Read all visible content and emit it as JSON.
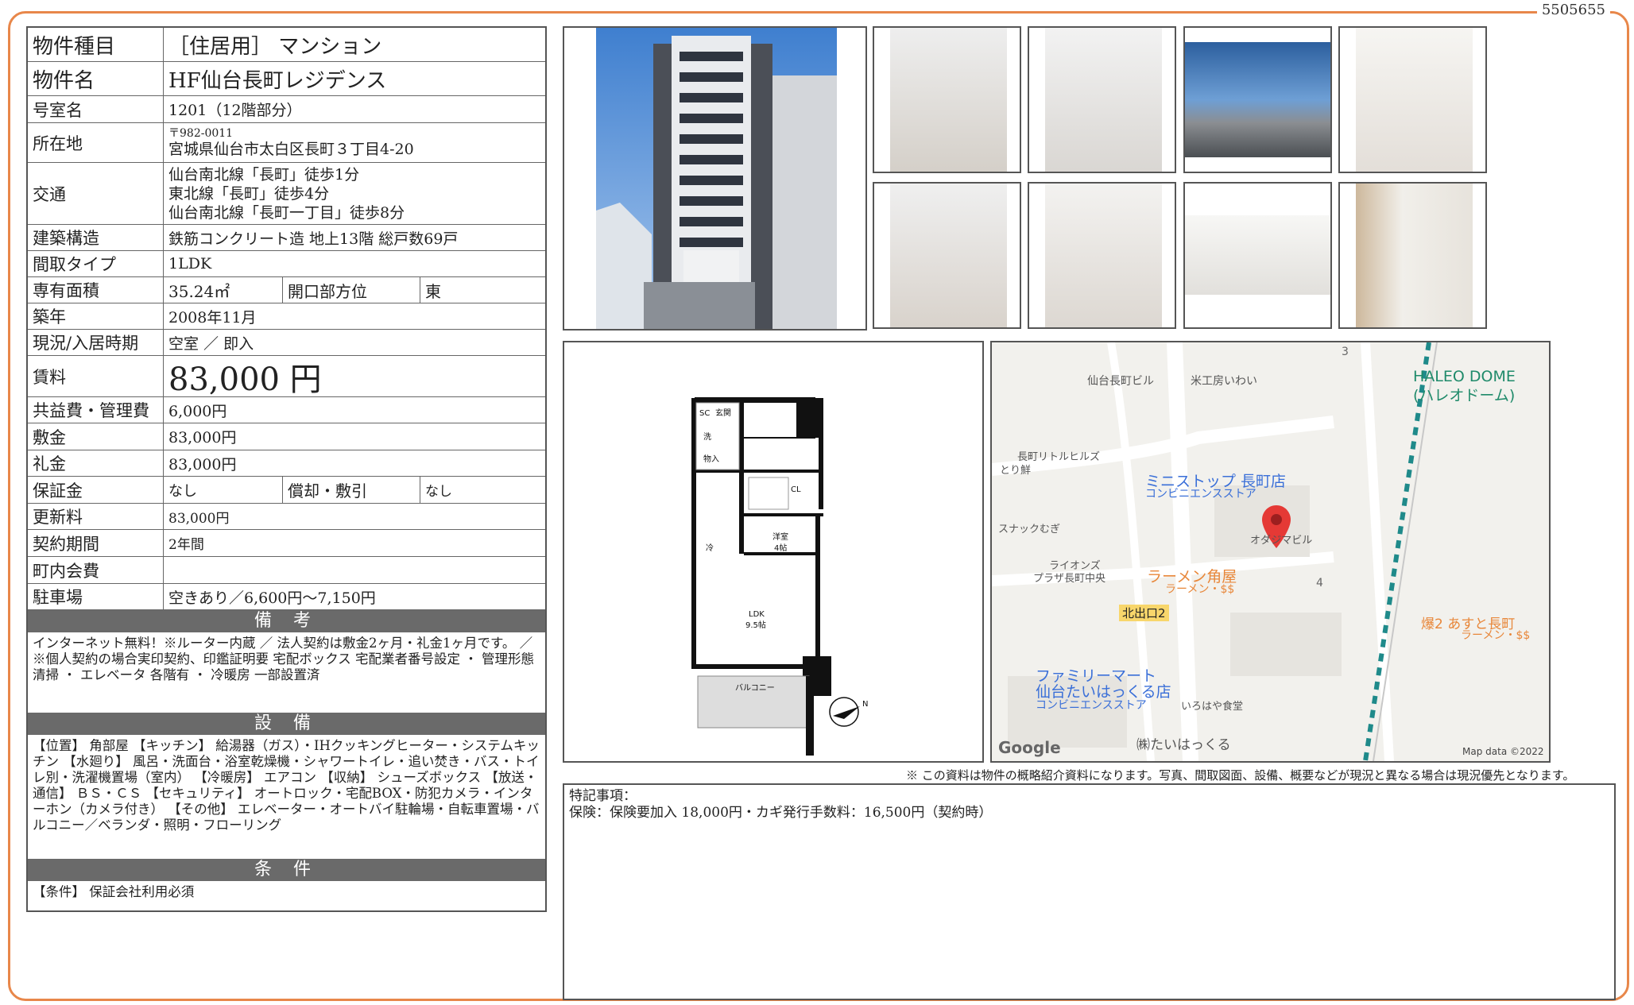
{
  "doc_id": "5505655",
  "spec": {
    "rows": [
      {
        "label": "物件種目",
        "value": "［住居用］ マンション"
      },
      {
        "label": "物件名",
        "value": "HF仙台長町レジデンス"
      },
      {
        "label": "号室名",
        "value": "1201（12階部分）"
      },
      {
        "label": "所在地",
        "postal": "〒982-0011",
        "value": "宮城県仙台市太白区長町３丁目4-20"
      },
      {
        "label": "交通",
        "lines": [
          "仙台南北線「長町」徒歩1分",
          "東北線「長町」徒歩4分",
          "仙台南北線「長町一丁目」徒歩8分"
        ]
      },
      {
        "label": "建築構造",
        "value": "鉄筋コンクリート造 地上13階 総戸数69戸"
      },
      {
        "label": "間取タイプ",
        "value": "1LDK"
      },
      {
        "label": "専有面積",
        "value": "35.24㎡",
        "sub_label": "開口部方位",
        "sub_value": "東"
      },
      {
        "label": "築年",
        "value": "2008年11月"
      },
      {
        "label": "現況/入居時期",
        "value": "空室 ／ 即入"
      },
      {
        "label": "賃料",
        "value": "83,000 円"
      },
      {
        "label": "共益費・管理費",
        "value": "6,000円"
      },
      {
        "label": "敷金",
        "value": "83,000円"
      },
      {
        "label": "礼金",
        "value": "83,000円"
      },
      {
        "label": "保証金",
        "value": "なし",
        "sub_label": "償却・敷引",
        "sub_value": "なし"
      },
      {
        "label": "更新料",
        "value": "83,000円"
      },
      {
        "label": "契約期間",
        "value": "2年間"
      },
      {
        "label": "町内会費",
        "value": ""
      },
      {
        "label": "駐車場",
        "value": "空きあり／6,600円～7,150円"
      }
    ]
  },
  "sections": {
    "biko_title": "備 考",
    "biko_text": "インターネット無料！※ルーター内蔵 ／ 法人契約は敷金2ヶ月・礼金1ヶ月です。 ／ ※個人契約の場合実印契約、印鑑証明要 宅配ボックス 宅配業者番号設定 ・ 管理形態 清掃 ・ エレベータ 各階有 ・ 冷暖房 一部設置済",
    "setsubi_title": "設 備",
    "setsubi_text": "【位置】 角部屋 【キッチン】 給湯器（ガス）・IHクッキングヒーター・システムキッチン 【水廻り】 風呂・洗面台・浴室乾燥機・シャワートイレ・追い焚き・バス・トイレ別・洗濯機置場（室内） 【冷暖房】 エアコン 【収納】 シューズボックス 【放送・通信】 ＢＳ・ＣＳ 【セキュリティ】 オートロック・宅配BOX・防犯カメラ・インターホン（カメラ付き） 【その他】 エレベーター・オートバイ駐輪場・自転車置場・バルコニー／ベランダ・照明・フローリング",
    "joken_title": "条 件",
    "joken_text": "【条件】 保証会社利用必須"
  },
  "floorplan": {
    "labels": [
      "SC",
      "玄関",
      "洗",
      "物入",
      "CL",
      "洋室",
      "4帖",
      "冷",
      "LDK",
      "9.5帖",
      "バルコニー",
      "N"
    ]
  },
  "map": {
    "labels": [
      "仙台長町ビル",
      "米工房いわい",
      "HALEO DOME",
      "(ハレオドーム)",
      "長町リトルヒルズ",
      "とり鮮",
      "ミニストップ 長町店",
      "コンビニエンスストア",
      "スナックむぎ",
      "オダジマビル",
      "ライオンズ",
      "プラザ長町中央",
      "ラーメン角屋",
      "ラーメン・$$",
      "北出口2",
      "爆2 あすと長町",
      "ラーメン・$$",
      "ファミリーマート",
      "仙台たいはっくる店",
      "コンビニエンスストア",
      "いろはや食堂",
      "㈱たいはっくる",
      "Google",
      "Map data ©2022",
      "3",
      "4"
    ]
  },
  "disclaimer": "※ この資料は物件の概略紹介資料になります。写真、間取図面、設備、概要などが現況と異なる場合は現況優先となります。",
  "remarks": {
    "title": "特記事項：",
    "text": "保険：保険要加入 18,000円・カギ発行手数料：16,500円（契約時）"
  },
  "colors": {
    "frame": "#e8874a",
    "section_header": "#6a6a6a",
    "map_pin": "#e53935",
    "rail": "#1f8a8a"
  }
}
